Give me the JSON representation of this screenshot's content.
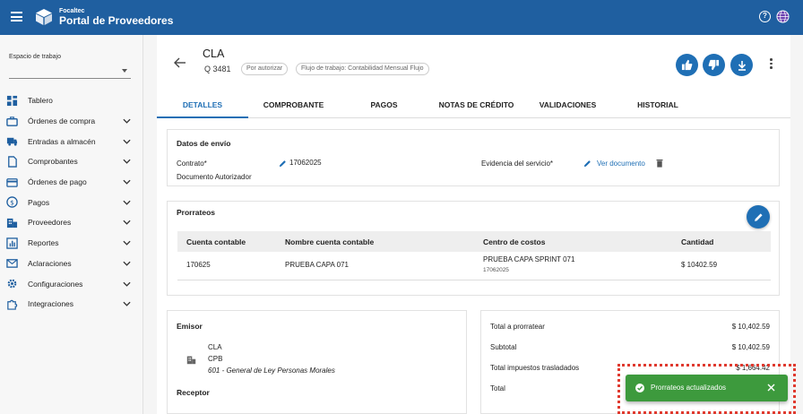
{
  "header": {
    "brand_small": "Focaltec",
    "brand_title": "Portal de Proveedores"
  },
  "sidebar": {
    "workspace_label": "Espacio de trabajo",
    "workspace_value": "",
    "items": [
      {
        "label": "Tablero",
        "icon": "dashboard-icon"
      },
      {
        "label": "Órdenes de compra",
        "icon": "briefcase-icon"
      },
      {
        "label": "Entradas a almacén",
        "icon": "truck-icon"
      },
      {
        "label": "Comprobantes",
        "icon": "document-icon"
      },
      {
        "label": "Órdenes de pago",
        "icon": "credit-card-icon"
      },
      {
        "label": "Pagos",
        "icon": "dollar-icon"
      },
      {
        "label": "Proveedores",
        "icon": "building-icon"
      },
      {
        "label": "Reportes",
        "icon": "chart-icon"
      },
      {
        "label": "Aclaraciones",
        "icon": "mail-icon"
      },
      {
        "label": "Configuraciones",
        "icon": "gear-icon"
      },
      {
        "label": "Integraciones",
        "icon": "puzzle-icon"
      }
    ]
  },
  "document": {
    "title": "CLA",
    "number": "Q 3481",
    "status_chip": "Por autorizar",
    "workflow_chip": "Flujo de trabajo: Contabilidad Mensual Flujo"
  },
  "tabs": [
    "DETALLES",
    "COMPROBANTE",
    "PAGOS",
    "NOTAS DE CRÉDITO",
    "VALIDACIONES",
    "HISTORIAL"
  ],
  "shipping": {
    "title": "Datos de envío",
    "contract_label": "Contrato*",
    "contract_value": "17062025",
    "authorizer_label": "Documento Autorizador",
    "evidence_label": "Evidencia del servicio*",
    "evidence_link": "Ver documento"
  },
  "prorrateos": {
    "title": "Prorrateos",
    "columns": [
      "Cuenta contable",
      "Nombre cuenta contable",
      "Centro de costos",
      "Cantidad"
    ],
    "rows": [
      {
        "account": "170625",
        "account_name": "PRUEBA CAPA 071",
        "cost_center": "PRUEBA CAPA SPRINT 071",
        "cost_center_code": "17062025",
        "amount": "$ 10402.59"
      }
    ]
  },
  "emisor": {
    "title": "Emisor",
    "name": "CLA",
    "rfc": "CPB",
    "regime": "601 - General de Ley Personas Morales",
    "receptor_title": "Receptor"
  },
  "totals": [
    {
      "label": "Total a prorratear",
      "value": "$ 10,402.59"
    },
    {
      "label": "Subtotal",
      "value": "$ 10,402.59"
    },
    {
      "label": "Total impuestos trasladados",
      "value": "$ 1,664.42"
    },
    {
      "label": "Total",
      "value": ""
    }
  ],
  "toast": {
    "message": "Prorrateos actualizados"
  },
  "colors": {
    "primary": "#1f5fa0",
    "accent": "#1f6fb5",
    "success": "#3d9a3d",
    "highlight": "#e03a2f"
  }
}
